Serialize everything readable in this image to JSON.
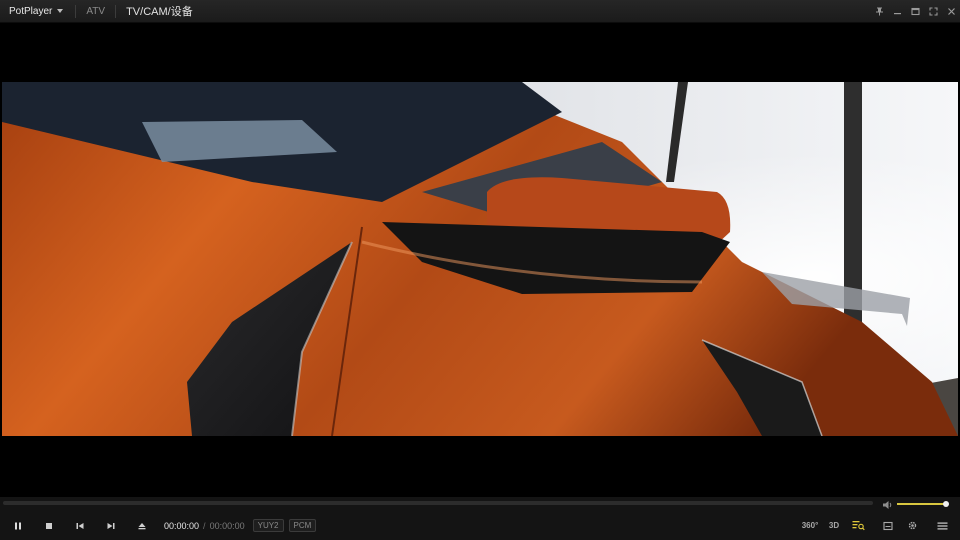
{
  "titlebar": {
    "app_name": "PotPlayer",
    "tabs": [
      "ATV",
      "TV/CAM/设备"
    ],
    "active_tab": "TV/CAM/设备",
    "controls": [
      "pin-icon",
      "minimize-icon",
      "maximize-icon",
      "fullscreen-icon",
      "close-icon"
    ]
  },
  "video": {
    "content": "orange-sports-car-frame"
  },
  "seekbar": {
    "progress_fraction": 0.0
  },
  "volume": {
    "level_fraction": 0.97,
    "accent_color": "#d8c640"
  },
  "controls": {
    "buttons": [
      "pause-icon",
      "stop-icon",
      "previous-icon",
      "next-icon",
      "eject-icon"
    ],
    "time_current": "00:00:00",
    "time_separator": "/",
    "time_total": "00:00:00",
    "video_format": "YUY2",
    "audio_format": "PCM",
    "right_buttons": {
      "vr360_label": "360°",
      "threed_label": "3D"
    }
  },
  "colors": {
    "titlebar_bg": "#1e1e1e",
    "controlbar_bg": "#141414",
    "playlist_icon_accent": "#e0c93a"
  }
}
